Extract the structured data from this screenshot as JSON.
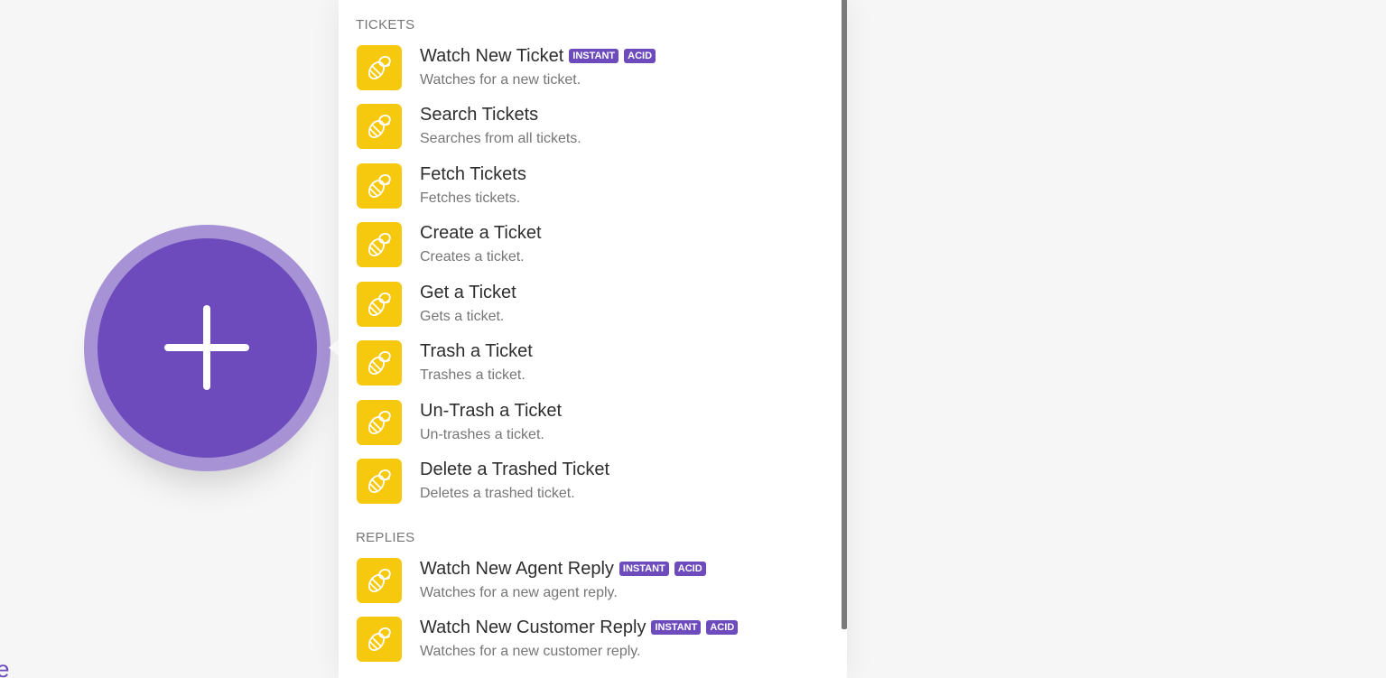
{
  "sections": [
    {
      "title": "TICKETS",
      "items": [
        {
          "title": "Watch New Ticket",
          "badges": [
            "INSTANT",
            "ACID"
          ],
          "desc": "Watches for a new ticket."
        },
        {
          "title": "Search Tickets",
          "badges": [],
          "desc": "Searches from all tickets."
        },
        {
          "title": "Fetch Tickets",
          "badges": [],
          "desc": "Fetches tickets."
        },
        {
          "title": "Create a Ticket",
          "badges": [],
          "desc": "Creates a ticket."
        },
        {
          "title": "Get a Ticket",
          "badges": [],
          "desc": "Gets a ticket."
        },
        {
          "title": "Trash a Ticket",
          "badges": [],
          "desc": "Trashes a ticket."
        },
        {
          "title": "Un-Trash a Ticket",
          "badges": [],
          "desc": "Un-trashes a ticket."
        },
        {
          "title": "Delete a Trashed Ticket",
          "badges": [],
          "desc": "Deletes a trashed ticket."
        }
      ]
    },
    {
      "title": "REPLIES",
      "items": [
        {
          "title": "Watch New Agent Reply",
          "badges": [
            "INSTANT",
            "ACID"
          ],
          "desc": "Watches for a new agent reply."
        },
        {
          "title": "Watch New Customer Reply",
          "badges": [
            "INSTANT",
            "ACID"
          ],
          "desc": "Watches for a new customer reply."
        }
      ]
    }
  ],
  "icons": {
    "module": "bee-icon",
    "add": "plus-icon"
  },
  "colors": {
    "accent": "#6d4bbd",
    "accent_ring": "#a792d6",
    "app_icon_bg": "#f6c90e"
  },
  "corner_glyph": "e"
}
